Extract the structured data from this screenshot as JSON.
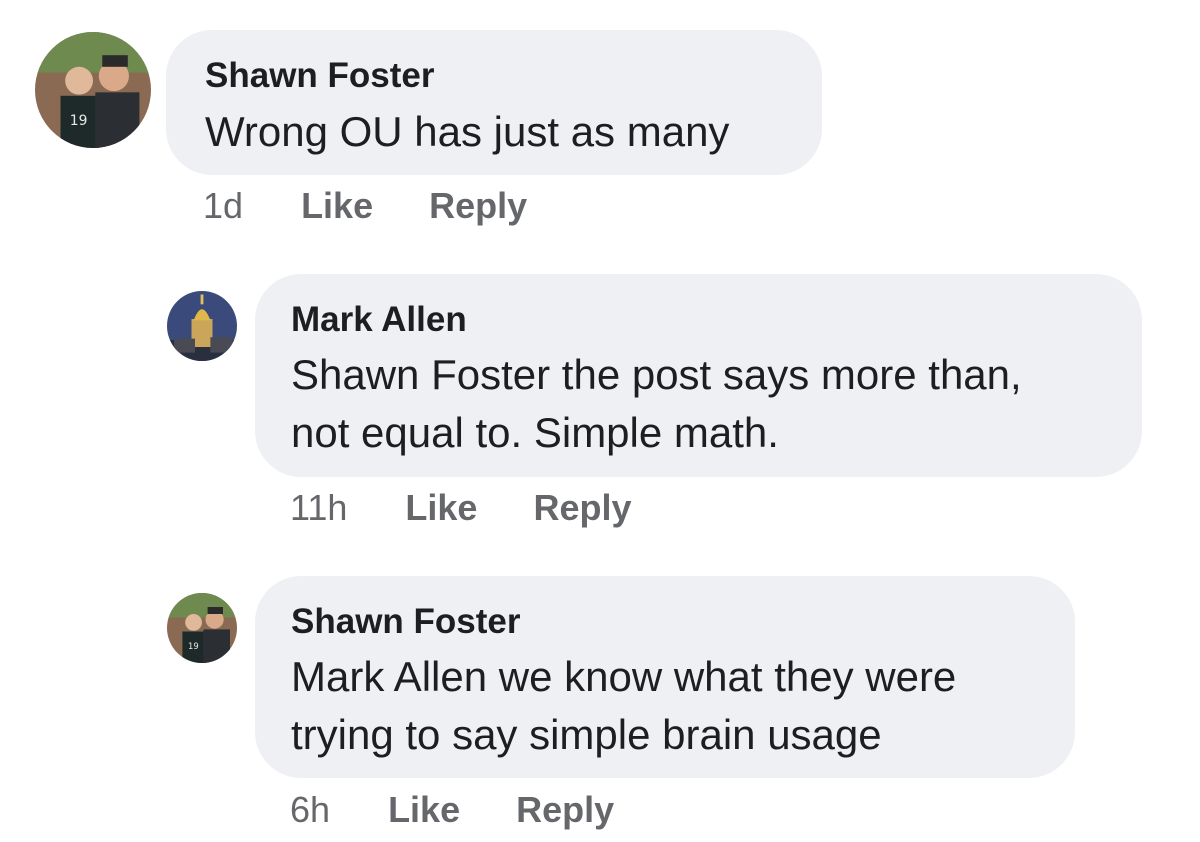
{
  "comments": [
    {
      "author": "Shawn Foster",
      "lines": [
        "Wrong OU has just as many"
      ],
      "time": "1d",
      "like_label": "Like",
      "reply_label": "Reply",
      "avatar": "profile-photo-two-men-stadium"
    },
    {
      "author": "Mark Allen",
      "lines": [
        "Shawn Foster the post says more than,",
        "not equal to.  Simple math."
      ],
      "time": "11h",
      "like_label": "Like",
      "reply_label": "Reply",
      "avatar": "profile-photo-golden-dome-night"
    },
    {
      "author": "Shawn Foster",
      "lines": [
        "Mark Allen we know what they were",
        "trying to say simple brain usage"
      ],
      "time": "6h",
      "like_label": "Like",
      "reply_label": "Reply",
      "avatar": "profile-photo-two-men-stadium"
    }
  ],
  "colors": {
    "bubble": "#eff0f3",
    "meta_text": "#65676b",
    "text": "#1c1e21"
  }
}
